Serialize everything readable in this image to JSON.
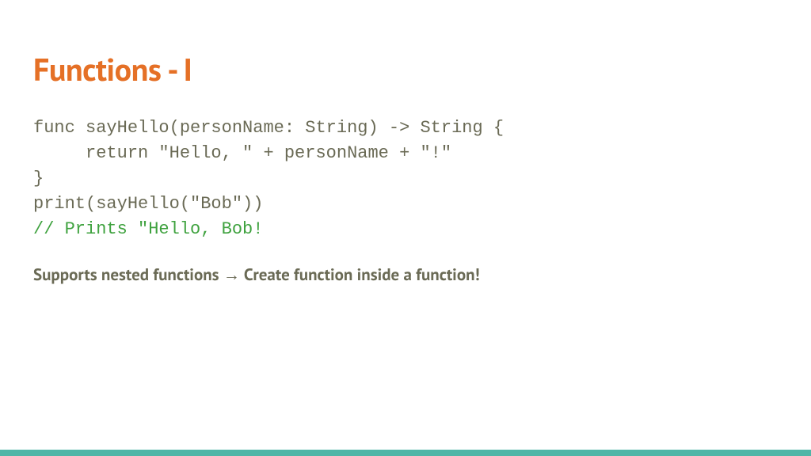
{
  "title": "Functions - I",
  "code": {
    "line1": "func sayHello(personName: String) -> String {",
    "line2": "     return \"Hello, \" + personName + \"!\"",
    "line3": "}",
    "line4": "print(sayHello(\"Bob\"))",
    "line5_comment": "// Prints \"Hello, Bob!"
  },
  "note": "Supports nested functions → Create function inside a function!",
  "colors": {
    "title": "#e57026",
    "code": "#6a6a55",
    "comment": "#3fa23f",
    "accent_bar": "#4fb6a7"
  }
}
